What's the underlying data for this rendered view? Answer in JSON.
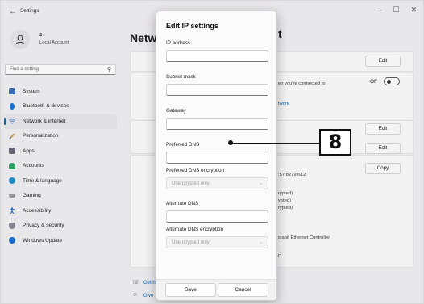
{
  "titlebar": {
    "back_icon": "back-arrow-icon",
    "title": "Settings",
    "minimize": "–",
    "maximize": "☐",
    "close": "✕"
  },
  "account": {
    "name": "z",
    "type": "Local Account"
  },
  "search": {
    "placeholder": "Find a setting"
  },
  "nav": {
    "items": [
      {
        "label": "System",
        "icon": "system-icon",
        "color": "#3a6fb5"
      },
      {
        "label": "Bluetooth & devices",
        "icon": "bluetooth-icon",
        "color": "#1b74d4"
      },
      {
        "label": "Network & internet",
        "icon": "network-icon",
        "color": "#4a7cc2"
      },
      {
        "label": "Personalization",
        "icon": "brush-icon",
        "color": "#c48a3a"
      },
      {
        "label": "Apps",
        "icon": "apps-icon",
        "color": "#6a6a7a"
      },
      {
        "label": "Accounts",
        "icon": "accounts-icon",
        "color": "#2fa36a"
      },
      {
        "label": "Time & language",
        "icon": "time-language-icon",
        "color": "#1f8fc9"
      },
      {
        "label": "Gaming",
        "icon": "gaming-icon",
        "color": "#7a7a7a"
      },
      {
        "label": "Accessibility",
        "icon": "accessibility-icon",
        "color": "#1d5fb8"
      },
      {
        "label": "Privacy & security",
        "icon": "shield-icon",
        "color": "#7a7a86"
      },
      {
        "label": "Windows Update",
        "icon": "update-icon",
        "color": "#1a6fcf"
      }
    ],
    "active_index": 2
  },
  "main": {
    "title_left": "Netw",
    "title_right": "t",
    "edit_label": "Edit",
    "copy_label": "Copy",
    "off_label": "Off",
    "connected_text": "en you're connected to",
    "network_link": "twork",
    "ipv6_text": ":57:8279%12",
    "encrypted_1": "rypted)",
    "encrypted_2": "ypted)",
    "encrypted_3": "rypted)",
    "adapter_text": "igabit Ethernet Controller",
    "f_text": "F",
    "get_help": "Get h",
    "give_feedback": "Give"
  },
  "dialog": {
    "title": "Edit IP settings",
    "ip_label": "IP address",
    "ip_value": "",
    "subnet_label": "Subnet mask",
    "subnet_value": "",
    "gateway_label": "Gateway",
    "gateway_value": "",
    "pref_dns_label": "Preferred DNS",
    "pref_dns_value": "",
    "pref_enc_label": "Preferred DNS encryption",
    "pref_enc_value": "Unencrypted only",
    "alt_dns_label": "Alternate DNS",
    "alt_dns_value": "",
    "alt_enc_label": "Alternate DNS encryption",
    "alt_enc_value": "Unencrypted only",
    "save_label": "Save",
    "cancel_label": "Cancel"
  },
  "callout": {
    "number": "8"
  }
}
